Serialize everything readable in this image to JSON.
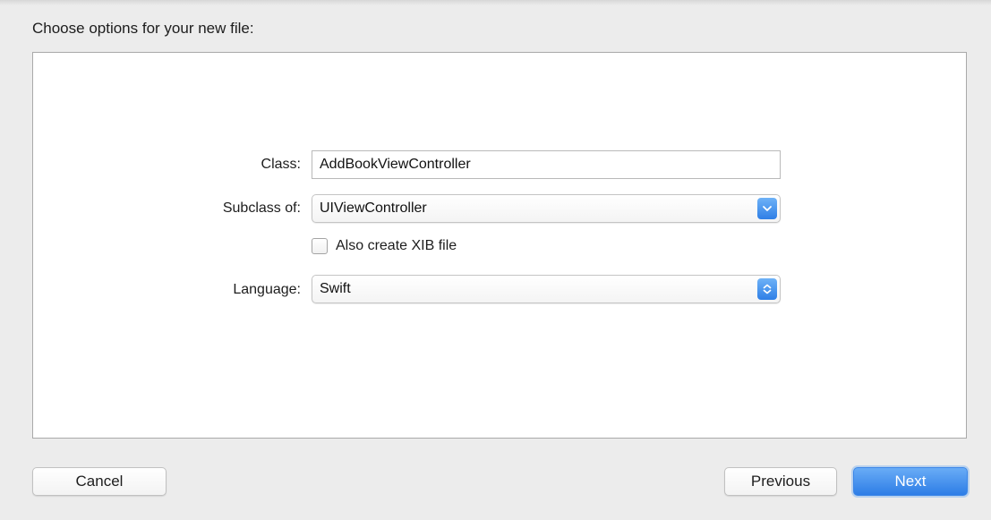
{
  "dialog": {
    "heading": "Choose options for your new file:"
  },
  "form": {
    "class_label": "Class:",
    "class_value": "AddBookViewController",
    "subclass_label": "Subclass of:",
    "subclass_value": "UIViewController",
    "xib_label": "Also create XIB file",
    "xib_checked": false,
    "language_label": "Language:",
    "language_value": "Swift"
  },
  "buttons": {
    "cancel": "Cancel",
    "previous": "Previous",
    "next": "Next"
  },
  "colors": {
    "accent": "#2d7de6",
    "background": "#ececec"
  },
  "icons": {
    "subclass_dropdown": "chevron-down-icon",
    "language_dropdown": "up-down-chevron-icon"
  }
}
